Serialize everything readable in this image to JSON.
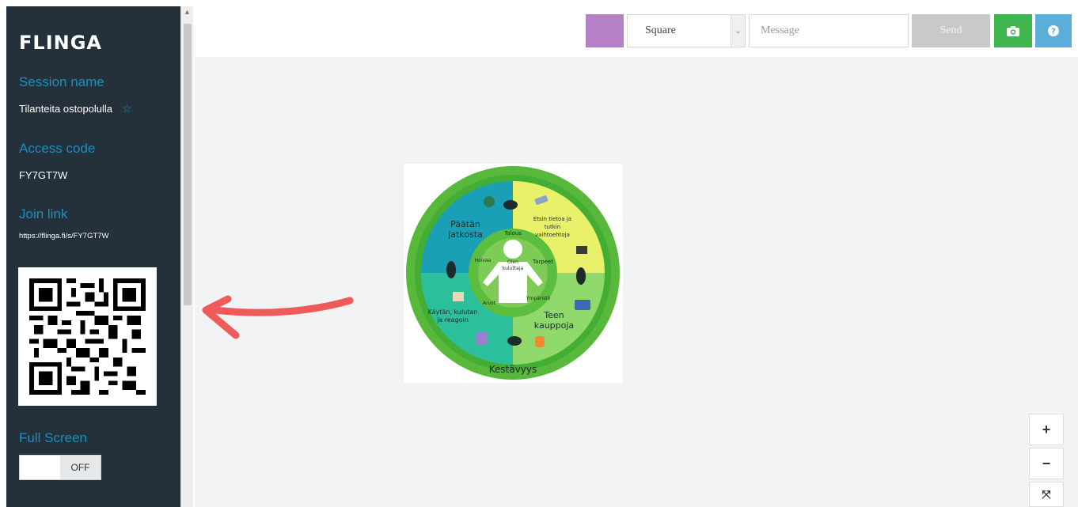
{
  "sidebar": {
    "brand": "FLINGA",
    "session_label": "Session name",
    "session_name": "Tilanteita ostopolulla",
    "access_label": "Access code",
    "access_code": "FY7GT7W",
    "join_label": "Join link",
    "join_link": "https://flinga.fi/s/FY7GT7W",
    "fullscreen_label": "Full Screen",
    "fullscreen_state": "OFF"
  },
  "toolbar": {
    "color": "#b580c5",
    "shape_value": "Square",
    "message_placeholder": "Message",
    "send_label": "Send"
  },
  "card": {
    "outer_label": "Kestävyys",
    "center_label": "Olen kuluttaja",
    "segments": [
      {
        "label": "Päätän jatkosta",
        "color": "#1aa0b6"
      },
      {
        "label": "Etsin tietoa ja tutkin vaihtoehtoja",
        "color": "#e9f06a"
      },
      {
        "label": "Teen kauppoja",
        "color": "#8fd96d"
      },
      {
        "label": "Käytän, kulutan ja reagoin",
        "color": "#2cbf9c"
      }
    ],
    "inner_words": [
      "Talous",
      "Tarpeet",
      "Hoivaa",
      "Arvot",
      "Ympäristö"
    ]
  },
  "zoom": {
    "in_label": "+",
    "out_label": "−",
    "fit_label": "⤧"
  }
}
